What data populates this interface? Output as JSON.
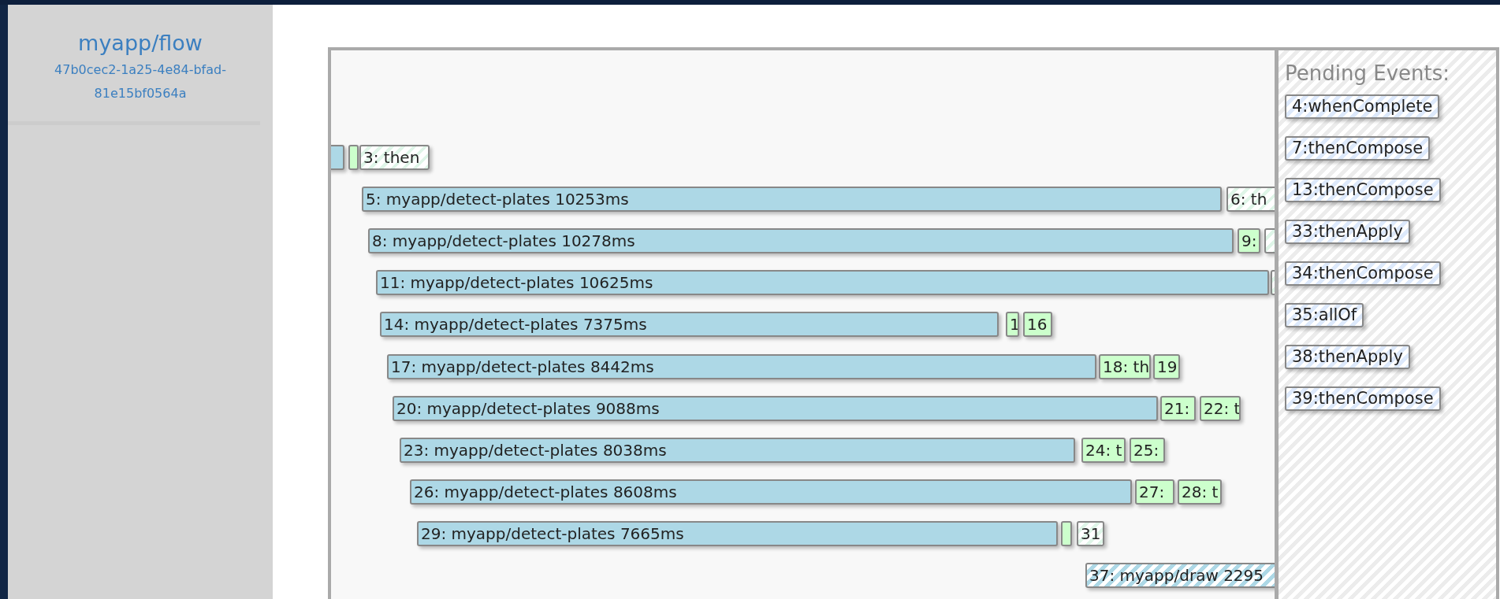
{
  "flow": {
    "title": "myapp/flow",
    "id": "47b0cec2-1a25-4e84-bfad-81e15bf0564a"
  },
  "timeline": {
    "rows": [
      {
        "items": [
          {
            "kind": "completed"
          },
          {
            "kind": "stage"
          },
          {
            "kind": "pending",
            "label": "3: then"
          }
        ]
      },
      {
        "items": [
          {
            "kind": "completed",
            "label": "5: myapp/detect-plates 10253ms"
          },
          {
            "kind": "pending",
            "label": "6: th"
          }
        ]
      },
      {
        "items": [
          {
            "kind": "completed",
            "label": "8: myapp/detect-plates 10278ms"
          },
          {
            "kind": "stage",
            "label": "9:"
          },
          {
            "kind": "pending"
          }
        ]
      },
      {
        "items": [
          {
            "kind": "completed",
            "label": "11: myapp/detect-plates 10625ms"
          },
          {
            "kind": "pending"
          }
        ]
      },
      {
        "items": [
          {
            "kind": "completed",
            "label": "14: myapp/detect-plates 7375ms"
          },
          {
            "kind": "stage",
            "label": "1"
          },
          {
            "kind": "stage",
            "label": "16"
          }
        ]
      },
      {
        "items": [
          {
            "kind": "completed",
            "label": "17: myapp/detect-plates 8442ms"
          },
          {
            "kind": "stage",
            "label": "18: th"
          },
          {
            "kind": "stage",
            "label": "19"
          }
        ]
      },
      {
        "items": [
          {
            "kind": "completed",
            "label": "20: myapp/detect-plates 9088ms"
          },
          {
            "kind": "stage",
            "label": "21:"
          },
          {
            "kind": "stage",
            "label": "22: t"
          }
        ]
      },
      {
        "items": [
          {
            "kind": "completed",
            "label": "23: myapp/detect-plates 8038ms"
          },
          {
            "kind": "stage",
            "label": "24: t"
          },
          {
            "kind": "stage",
            "label": "25:"
          }
        ]
      },
      {
        "items": [
          {
            "kind": "completed",
            "label": "26: myapp/detect-plates 8608ms"
          },
          {
            "kind": "stage",
            "label": "27:"
          },
          {
            "kind": "stage",
            "label": "28: t"
          }
        ]
      },
      {
        "items": [
          {
            "kind": "completed",
            "label": "29: myapp/detect-plates 7665ms"
          },
          {
            "kind": "stage"
          },
          {
            "kind": "pending",
            "label": "31"
          }
        ]
      },
      {
        "items": [
          {
            "kind": "running",
            "label": "37: myapp/draw 2295"
          }
        ]
      }
    ]
  },
  "pending_events": {
    "title": "Pending Events:",
    "events": [
      "4:whenComplete",
      "7:thenCompose",
      "13:thenCompose",
      "33:thenApply",
      "34:thenCompose",
      "35:allOf",
      "38:thenApply",
      "39:thenCompose"
    ]
  }
}
